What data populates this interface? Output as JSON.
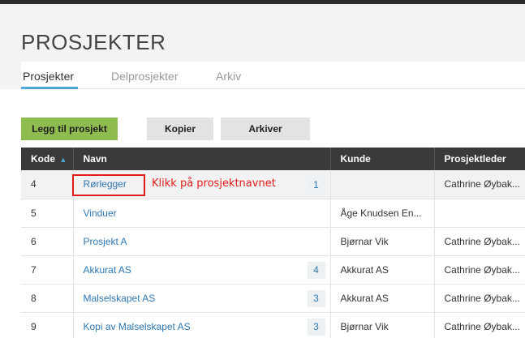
{
  "page": {
    "title": "PROSJEKTER"
  },
  "tabs": [
    {
      "label": "Prosjekter",
      "active": true
    },
    {
      "label": "Delprosjekter",
      "active": false
    },
    {
      "label": "Arkiv",
      "active": false
    }
  ],
  "toolbar": {
    "add_label": "Legg til prosjekt",
    "copy_label": "Kopier",
    "archive_label": "Arkiver"
  },
  "table": {
    "headers": {
      "kode": "Kode",
      "navn": "Navn",
      "kunde": "Kunde",
      "prosjektleder": "Prosjektleder"
    },
    "sort_indicator": "▲",
    "rows": [
      {
        "kode": "4",
        "navn": "Rørlegger",
        "count": "1",
        "kunde": "",
        "prosjektleder": "Cathrine Øybak..."
      },
      {
        "kode": "5",
        "navn": "Vinduer",
        "count": "",
        "kunde": "Åge Knudsen En...",
        "prosjektleder": ""
      },
      {
        "kode": "6",
        "navn": "Prosjekt A",
        "count": "",
        "kunde": "Bjørnar Vik",
        "prosjektleder": "Cathrine Øybak..."
      },
      {
        "kode": "7",
        "navn": "Akkurat AS",
        "count": "4",
        "kunde": "Akkurat AS",
        "prosjektleder": "Cathrine Øybak..."
      },
      {
        "kode": "8",
        "navn": "Malselskapet AS",
        "count": "3",
        "kunde": "Akkurat AS",
        "prosjektleder": "Cathrine Øybak..."
      },
      {
        "kode": "9",
        "navn": "Kopi av Malselskapet AS",
        "count": "3",
        "kunde": "Bjørnar Vik",
        "prosjektleder": "Cathrine Øybak..."
      }
    ]
  },
  "annotation": {
    "text": "Klikk på prosjektnavnet",
    "color": "#e01b1b"
  },
  "colors": {
    "accent": "#4ea7d8",
    "primary_button": "#8fbc4f",
    "header_bg": "#3a3a3a",
    "link": "#2e77b3"
  }
}
